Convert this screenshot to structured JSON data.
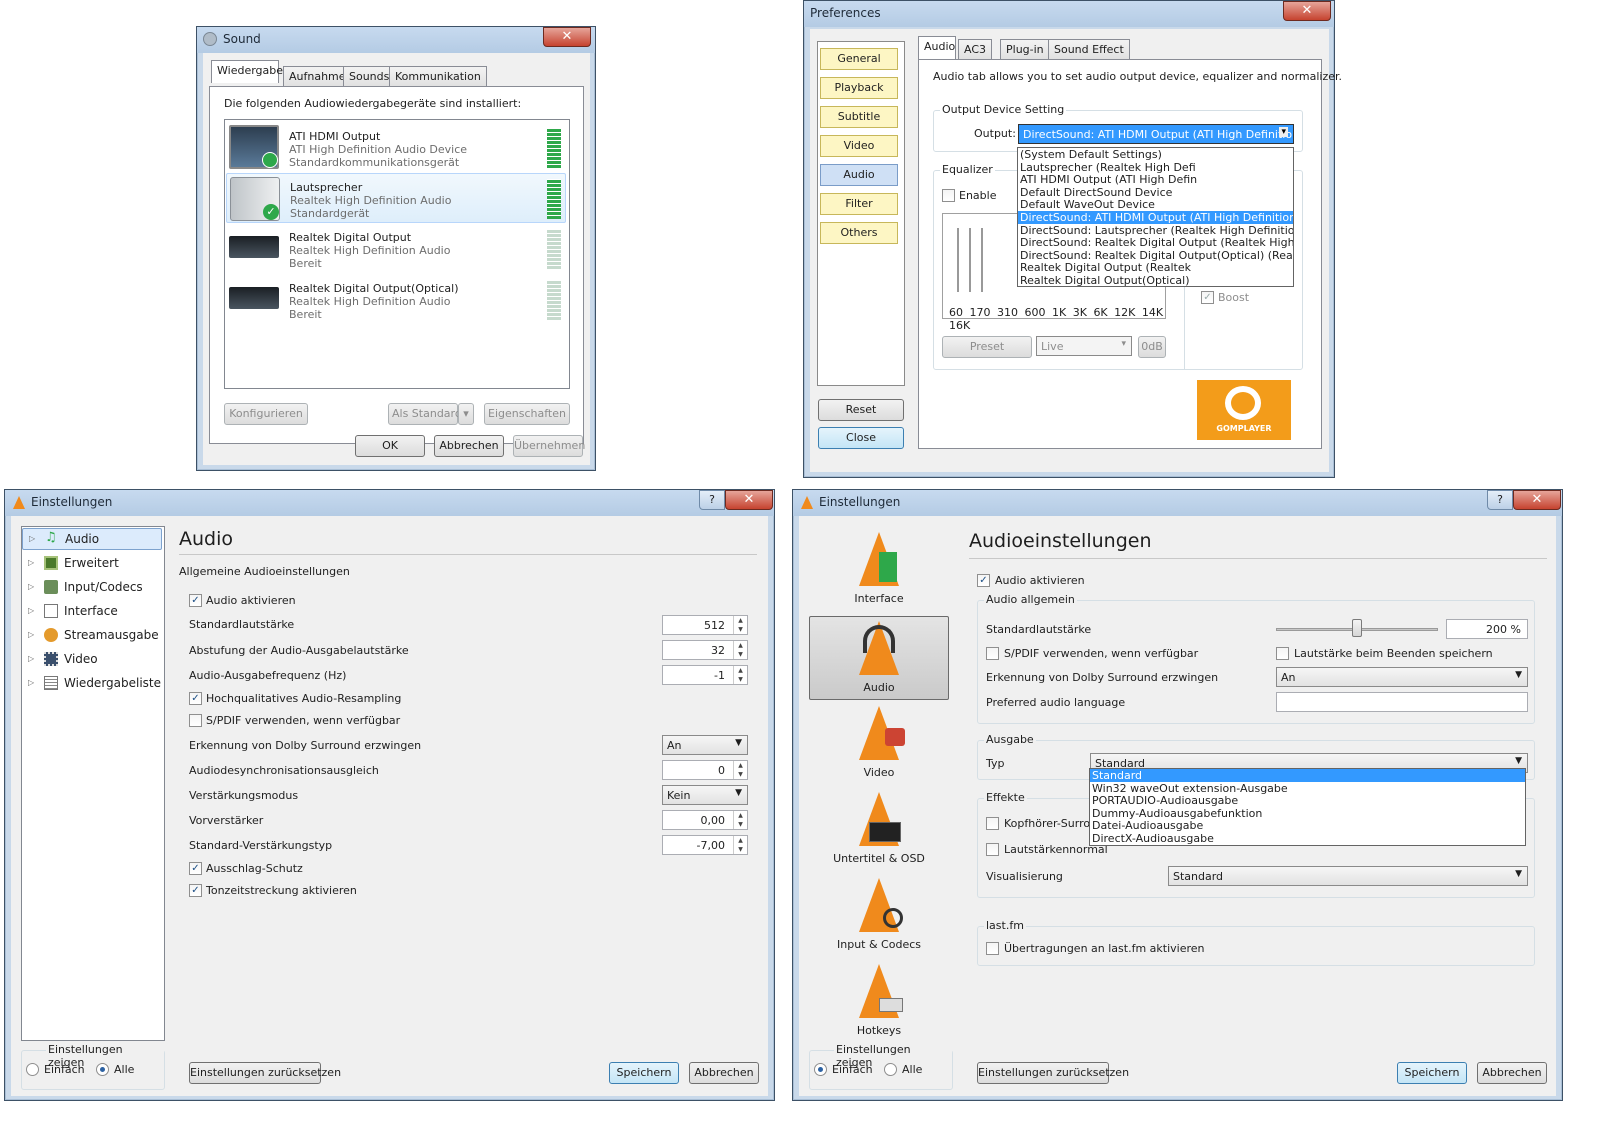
{
  "sound": {
    "title": "Sound",
    "tabs": [
      "Wiedergabe",
      "Aufnahme",
      "Sounds",
      "Kommunikation"
    ],
    "heading": "Die folgenden Audiowiedergabegeräte sind installiert:",
    "devices": [
      {
        "name": "ATI HDMI Output",
        "sub": "ATI High Definition Audio Device",
        "status": "Standardkommunikationsgerät"
      },
      {
        "name": "Lautsprecher",
        "sub": "Realtek High Definition Audio",
        "status": "Standardgerät"
      },
      {
        "name": "Realtek Digital Output",
        "sub": "Realtek High Definition Audio",
        "status": "Bereit"
      },
      {
        "name": "Realtek Digital Output(Optical)",
        "sub": "Realtek High Definition Audio",
        "status": "Bereit"
      }
    ],
    "configure": "Konfigurieren",
    "set_default": "Als Standard",
    "properties": "Eigenschaften",
    "ok": "OK",
    "cancel": "Abbrechen",
    "apply": "Übernehmen"
  },
  "gom": {
    "title": "Preferences",
    "nav": [
      "General",
      "Playback",
      "Subtitle",
      "Video",
      "Audio",
      "Filter",
      "Others"
    ],
    "reset": "Reset",
    "close": "Close",
    "tabs": [
      "Audio",
      "AC3",
      "Plug-in",
      "Sound Effect"
    ],
    "intro": "Audio tab allows you to set audio output device, equalizer and normalizer.",
    "output_group": "Output Device Setting",
    "output_label": "Output:",
    "output_value": "DirectSound: ATI HDMI Output (ATI High Definition Auc",
    "dropdown": [
      "(System Default Settings)",
      "Lautsprecher (Realtek High Defi",
      "ATI HDMI Output (ATI High Defin",
      "Default DirectSound Device",
      "Default WaveOut Device",
      "DirectSound: ATI HDMI Output (ATI High Definition Audio D",
      "DirectSound: Lautsprecher (Realtek High Definition Audio)",
      "DirectSound: Realtek Digital Output (Realtek High Definitior",
      "DirectSound: Realtek Digital Output(Optical) (Realtek High I",
      "Realtek Digital Output (Realtek",
      "Realtek Digital Output(Optical)"
    ],
    "eq_group": "Equalizer",
    "enable": "Enable",
    "bands": [
      "60",
      "170",
      "310",
      "600",
      "1K",
      "3K",
      "6K",
      "12K",
      "14K",
      "16K"
    ],
    "preset": "Preset",
    "live": "Live",
    "odb": "0dB",
    "boost": "Boost",
    "logo": "GOMPLAYER"
  },
  "vlc1": {
    "title": "Einstellungen",
    "help": "?",
    "nav": [
      "Audio",
      "Erweitert",
      "Input/Codecs",
      "Interface",
      "Streamausgabe",
      "Video",
      "Wiedergabeliste"
    ],
    "heading": "Audio",
    "section": "Allgemeine Audioeinstellungen",
    "rows": {
      "audio_on": "Audio aktivieren",
      "std_vol": "Standardlautstärke",
      "std_vol_v": "512",
      "step": "Abstufung der Audio-Ausgabelautstärke",
      "step_v": "32",
      "freq": "Audio-Ausgabefrequenz (Hz)",
      "freq_v": "-1",
      "hq": "Hochqualitatives Audio-Resampling",
      "spdif": "S/PDIF verwenden, wenn verfügbar",
      "dolby": "Erkennung von Dolby Surround erzwingen",
      "dolby_v": "An",
      "desync": "Audiodesynchronisationsausgleich",
      "desync_v": "0",
      "gain": "Verstärkungsmodus",
      "gain_v": "Kein",
      "preamp": "Vorverstärker",
      "preamp_v": "0,00",
      "gaintype": "Standard-Verstärkungstyp",
      "gaintype_v": "-7,00",
      "clip": "Ausschlag-Schutz",
      "stretch": "Tonzeitstreckung aktivieren"
    },
    "show": "Einstellungen zeigen",
    "simple": "Einfach",
    "all": "Alle",
    "reset": "Einstellungen zurücksetzen",
    "save": "Speichern",
    "cancel": "Abbrechen"
  },
  "vlc2": {
    "title": "Einstellungen",
    "help": "?",
    "nav": [
      "Interface",
      "Audio",
      "Video",
      "Untertitel & OSD",
      "Input & Codecs",
      "Hotkeys"
    ],
    "heading": "Audioeinstellungen",
    "audio_on": "Audio aktivieren",
    "general": "Audio allgemein",
    "std_vol": "Standardlautstärke",
    "vol_v": "200 %",
    "spdif": "S/PDIF verwenden, wenn verfügbar",
    "save_vol": "Lautstärke beim Beenden speichern",
    "dolby": "Erkennung von Dolby Surround erzwingen",
    "dolby_v": "An",
    "lang": "Preferred audio language",
    "output": "Ausgabe",
    "type": "Typ",
    "type_v": "Standard",
    "dropdown": [
      "Standard",
      "Win32 waveOut extension-Ausgabe",
      "PORTAUDIO-Audioausgabe",
      "Dummy-Audioausgabefunktion",
      "Datei-Audioausgabe",
      "DirectX-Audioausgabe"
    ],
    "effects": "Effekte",
    "headphone": "Kopfhörer-Surrour",
    "normal": "Lautstärkennormal",
    "visual": "Visualisierung",
    "visual_v": "Standard",
    "lastfm": "last.fm",
    "lastfm_on": "Übertragungen an last.fm aktivieren",
    "show": "Einstellungen zeigen",
    "simple": "Einfach",
    "all": "Alle",
    "reset": "Einstellungen zurücksetzen",
    "save": "Speichern",
    "cancel": "Abbrechen"
  }
}
